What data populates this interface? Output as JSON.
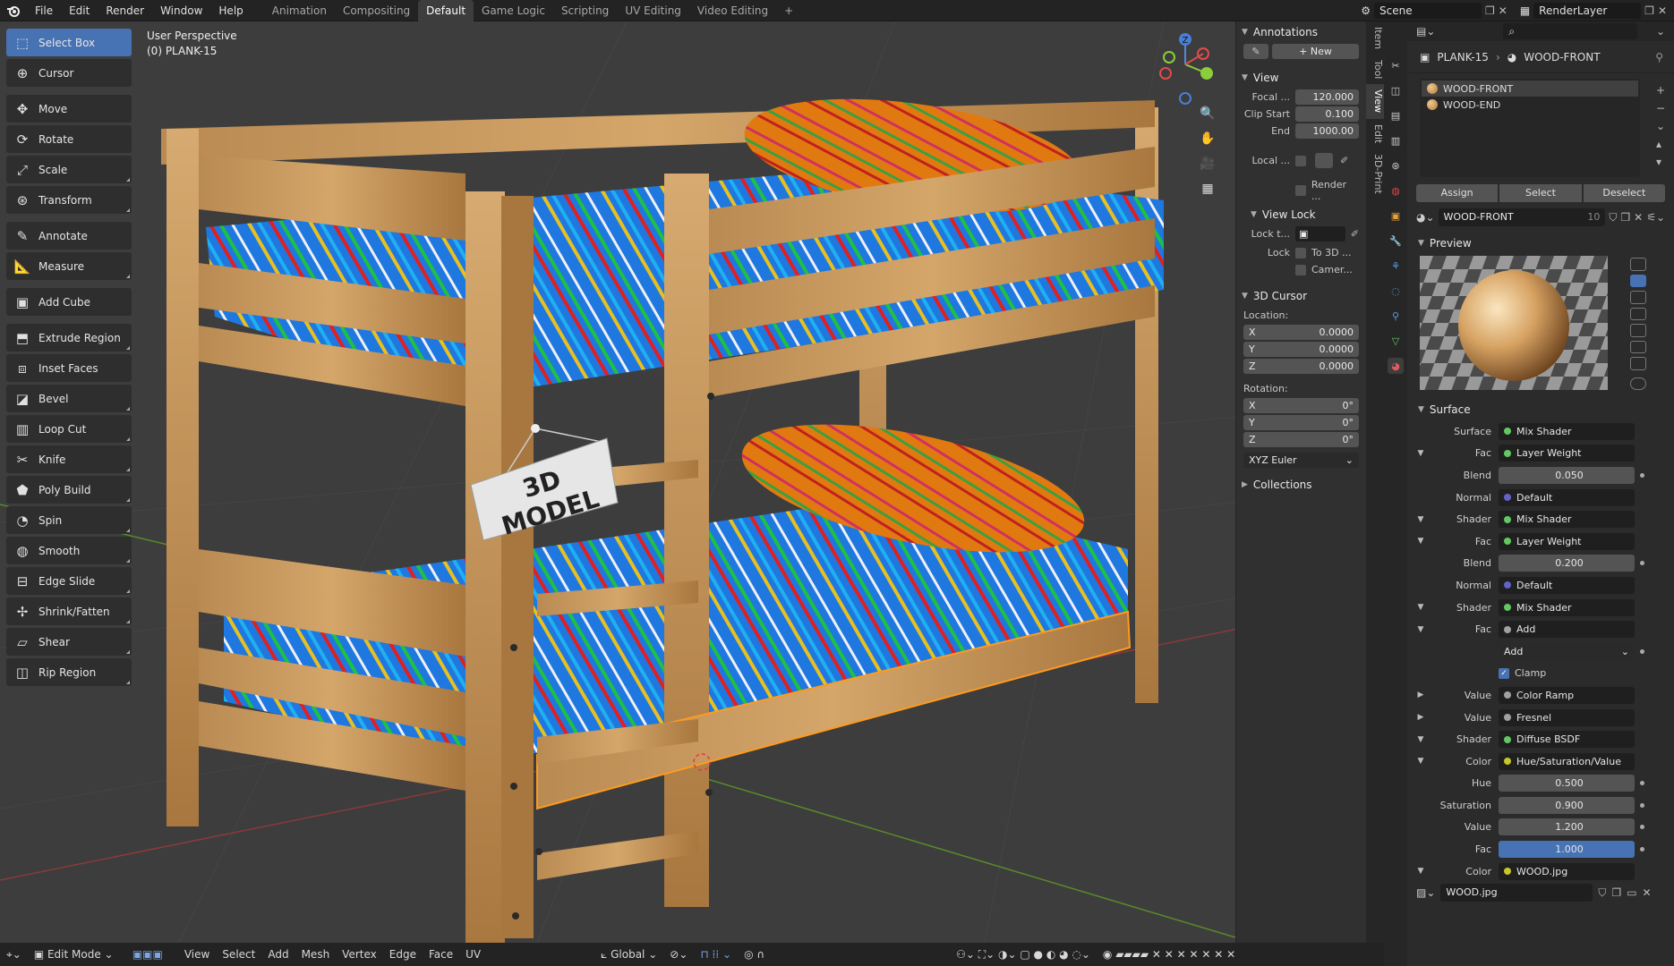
{
  "topbar": {
    "menus": [
      "File",
      "Edit",
      "Render",
      "Window",
      "Help"
    ],
    "workspaces": [
      "Animation",
      "Compositing",
      "Default",
      "Game Logic",
      "Scripting",
      "UV Editing",
      "Video Editing"
    ],
    "active_workspace": "Default",
    "scene": "Scene",
    "view_layer": "RenderLayer"
  },
  "viewport": {
    "view_name": "User Perspective",
    "object_name": "(0) PLANK-15",
    "sign_text": "3D MODEL"
  },
  "tools": [
    {
      "label": "Select Box",
      "icon": "select-box-icon",
      "active": true
    },
    {
      "label": "Cursor",
      "icon": "cursor-icon"
    },
    {
      "label": "Move",
      "icon": "move-icon"
    },
    {
      "label": "Rotate",
      "icon": "rotate-icon"
    },
    {
      "label": "Scale",
      "icon": "scale-icon"
    },
    {
      "label": "Transform",
      "icon": "transform-icon"
    },
    {
      "label": "Annotate",
      "icon": "annotate-icon"
    },
    {
      "label": "Measure",
      "icon": "measure-icon"
    },
    {
      "label": "Add Cube",
      "icon": "add-cube-icon"
    },
    {
      "label": "Extrude Region",
      "icon": "extrude-icon"
    },
    {
      "label": "Inset Faces",
      "icon": "inset-icon"
    },
    {
      "label": "Bevel",
      "icon": "bevel-icon"
    },
    {
      "label": "Loop Cut",
      "icon": "loop-cut-icon"
    },
    {
      "label": "Knife",
      "icon": "knife-icon"
    },
    {
      "label": "Poly Build",
      "icon": "poly-build-icon"
    },
    {
      "label": "Spin",
      "icon": "spin-icon"
    },
    {
      "label": "Smooth",
      "icon": "smooth-icon"
    },
    {
      "label": "Edge Slide",
      "icon": "edge-slide-icon"
    },
    {
      "label": "Shrink/Fatten",
      "icon": "shrink-fatten-icon"
    },
    {
      "label": "Shear",
      "icon": "shear-icon"
    },
    {
      "label": "Rip Region",
      "icon": "rip-region-icon"
    }
  ],
  "npanel": {
    "annotations": "Annotations",
    "new_label": "New",
    "view": "View",
    "focal_label": "Focal ...",
    "focal": "120.000",
    "clip_start_label": "Clip Start",
    "clip_start": "0.100",
    "end_label": "End",
    "clip_end": "1000.00",
    "local_label": "Local ...",
    "render_label": "Render ...",
    "view_lock": "View Lock",
    "lock_t_label": "Lock t...",
    "lock_label": "Lock",
    "to3d_label": "To 3D ...",
    "camera_label": "Camer...",
    "cursor3d": "3D Cursor",
    "location_label": "Location:",
    "loc": [
      {
        "axis": "X",
        "val": "0.0000"
      },
      {
        "axis": "Y",
        "val": "0.0000"
      },
      {
        "axis": "Z",
        "val": "0.0000"
      }
    ],
    "rotation_label": "Rotation:",
    "rot": [
      {
        "axis": "X",
        "val": "0°"
      },
      {
        "axis": "Y",
        "val": "0°"
      },
      {
        "axis": "Z",
        "val": "0°"
      }
    ],
    "rot_mode": "XYZ Euler",
    "collections": "Collections",
    "tabs": [
      "Item",
      "Tool",
      "View",
      "Edit",
      "3D-Print"
    ],
    "active_tab": "View"
  },
  "header": {
    "mode": "Edit Mode",
    "menus": [
      "View",
      "Select",
      "Add",
      "Mesh",
      "Vertex",
      "Edge",
      "Face",
      "UV"
    ],
    "orientation": "Global"
  },
  "props": {
    "object": "PLANK-15",
    "material": "WOOD-FRONT",
    "slots": [
      "WOOD-FRONT",
      "WOOD-END"
    ],
    "assign": "Assign",
    "select": "Select",
    "deselect": "Deselect",
    "mat_users": "10",
    "preview": "Preview",
    "surface_section": "Surface",
    "surface_rows": [
      {
        "label": "Surface",
        "value": "Mix Shader",
        "dot": "g",
        "tog": ""
      },
      {
        "label": "Fac",
        "value": "Layer Weight",
        "dot": "g",
        "tog": "▼"
      },
      {
        "label": "Blend",
        "value": "0.050",
        "num": true,
        "tog": ""
      },
      {
        "label": "Normal",
        "value": "Default",
        "dot": "p",
        "tog": ""
      },
      {
        "label": "Shader",
        "value": "Mix Shader",
        "dot": "g",
        "tog": "▼"
      },
      {
        "label": "Fac",
        "value": "Layer Weight",
        "dot": "g",
        "tog": "▼"
      },
      {
        "label": "Blend",
        "value": "0.200",
        "num": true,
        "tog": ""
      },
      {
        "label": "Normal",
        "value": "Default",
        "dot": "p",
        "tog": ""
      },
      {
        "label": "Shader",
        "value": "Mix Shader",
        "dot": "g",
        "tog": "▼"
      },
      {
        "label": "Fac",
        "value": "Add",
        "dot": "gr",
        "tog": "▼"
      },
      {
        "label": "",
        "value": "Add",
        "select": true,
        "tog": ""
      },
      {
        "label": "",
        "value": "Clamp",
        "check": true,
        "tog": ""
      },
      {
        "label": "Value",
        "value": "Color Ramp",
        "dot": "gr",
        "tog": "▶"
      },
      {
        "label": "Value",
        "value": "Fresnel",
        "dot": "gr",
        "tog": "▶"
      },
      {
        "label": "Shader",
        "value": "Diffuse BSDF",
        "dot": "g",
        "tog": "▼"
      },
      {
        "label": "Color",
        "value": "Hue/Saturation/Value",
        "dot": "y",
        "tog": "▼"
      },
      {
        "label": "Hue",
        "value": "0.500",
        "num": true,
        "tog": ""
      },
      {
        "label": "Saturation",
        "value": "0.900",
        "num": true,
        "tog": ""
      },
      {
        "label": "Value",
        "value": "1.200",
        "num": true,
        "tog": ""
      },
      {
        "label": "Fac",
        "value": "1.000",
        "num": true,
        "hl": true,
        "tog": ""
      },
      {
        "label": "Color",
        "value": "WOOD.jpg",
        "dot": "y",
        "tog": "▼"
      }
    ],
    "image_name": "WOOD.jpg"
  }
}
